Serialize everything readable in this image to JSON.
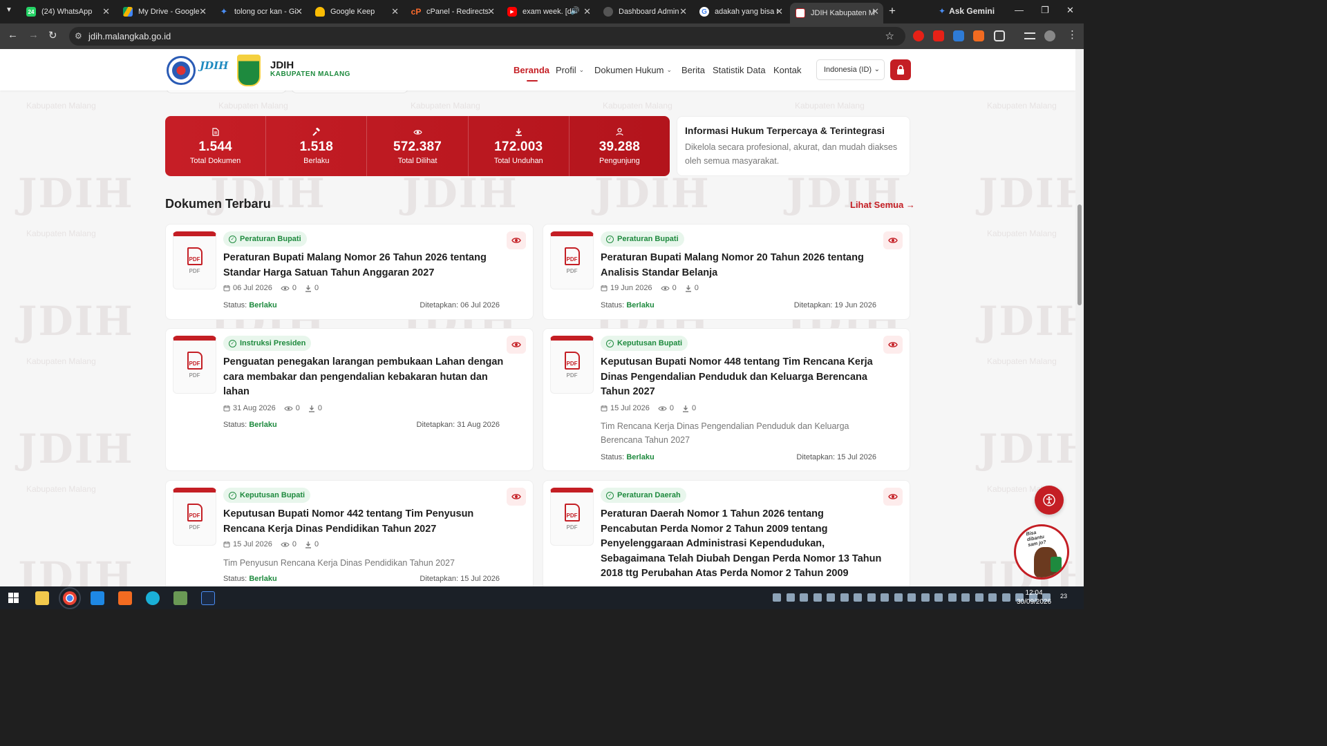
{
  "browser": {
    "tabs": [
      {
        "label": "(24) WhatsApp",
        "icon": "whatsapp-icon",
        "color": "#25d366",
        "badge": "24"
      },
      {
        "label": "My Drive - Google",
        "icon": "drive-icon",
        "color": "#f4b400"
      },
      {
        "label": "tolong ocr kan - Gi",
        "icon": "gemini-icon",
        "color": "#4b8ef5"
      },
      {
        "label": "Google Keep",
        "icon": "keep-icon",
        "color": "#fbbc04"
      },
      {
        "label": "cPanel - Redirects",
        "icon": "cpanel-icon",
        "color": "#ff6c2c"
      },
      {
        "label": "exam week. [de",
        "icon": "youtube-icon",
        "color": "#ff0000"
      },
      {
        "label": "Dashboard Admin",
        "icon": "globe-icon",
        "color": "#888888"
      },
      {
        "label": "adakah yang bisa r",
        "icon": "google-icon",
        "color": "#4285f4"
      },
      {
        "label": "JDIH Kabupaten M",
        "icon": "jdih-icon",
        "color": "#c41e24"
      }
    ],
    "ask_gemini": "Ask Gemini",
    "url": "jdih.malangkab.go.id"
  },
  "watermark": {
    "logo": "JDIH",
    "caption": "Kabupaten Malang"
  },
  "header": {
    "brand_title": "JDIH",
    "brand_sub": "KABUPATEN MALANG",
    "nav": [
      {
        "label": "Beranda",
        "active": true
      },
      {
        "label": "Profil",
        "dropdown": true
      },
      {
        "label": "Dokumen Hukum",
        "dropdown": true
      },
      {
        "label": "Berita"
      },
      {
        "label": "Statistik Data"
      },
      {
        "label": "Kontak"
      }
    ],
    "language": "Indonesia (ID)"
  },
  "stats": [
    {
      "icon": "document-icon",
      "value": "1.544",
      "label": "Total Dokumen"
    },
    {
      "icon": "gavel-icon",
      "value": "1.518",
      "label": "Berlaku"
    },
    {
      "icon": "eye-icon",
      "value": "572.387",
      "label": "Total Dilihat"
    },
    {
      "icon": "download-icon",
      "value": "172.003",
      "label": "Total Unduhan"
    },
    {
      "icon": "user-icon",
      "value": "39.288",
      "label": "Pengunjung"
    }
  ],
  "info": {
    "title": "Informasi Hukum Terpercaya & Terintegrasi",
    "text": "Dikelola secara profesional, akurat, dan mudah diakses oleh semua masyarakat."
  },
  "section": {
    "title": "Dokumen Terbaru",
    "see_all": "Lihat Semua →"
  },
  "documents": [
    {
      "category": "Peraturan Bupati",
      "title_lines": [
        "Peraturan Bupati Malang Nomor 26 Tahun 2026 tentang",
        "Standar Harga Satuan Tahun Anggaran 2027"
      ],
      "date": "06 Jul 2026",
      "views": "0",
      "downloads": "0",
      "description": "",
      "status_label": "Status:",
      "status": "Berlaku",
      "enacted": "Ditetapkan: 06 Jul 2026",
      "pdf_label": "PDF"
    },
    {
      "category": "Peraturan Bupati",
      "title_lines": [
        "Peraturan Bupati Malang Nomor 20 Tahun 2026 tentang",
        "Analisis Standar Belanja"
      ],
      "date": "19 Jun 2026",
      "views": "0",
      "downloads": "0",
      "description": "",
      "status_label": "Status:",
      "status": "Berlaku",
      "enacted": "Ditetapkan: 19 Jun 2026",
      "pdf_label": "PDF"
    },
    {
      "category": "Instruksi Presiden",
      "title_lines": [
        "Penguatan penegakan larangan pembukaan Lahan dengan",
        "cara membakar dan pengendalian kebakaran hutan dan",
        "lahan"
      ],
      "date": "31 Aug 2026",
      "views": "0",
      "downloads": "0",
      "description": "",
      "status_label": "Status:",
      "status": "Berlaku",
      "enacted": "Ditetapkan: 31 Aug 2026",
      "pdf_label": "PDF"
    },
    {
      "category": "Keputusan Bupati",
      "title_lines": [
        "Keputusan Bupati Nomor 448 tentang Tim Rencana Kerja",
        "Dinas Pengendalian Penduduk dan Keluarga Berencana",
        "Tahun 2027"
      ],
      "date": "15 Jul 2026",
      "views": "0",
      "downloads": "0",
      "description_lines": [
        "Tim Rencana Kerja Dinas Pengendalian Penduduk dan Keluarga",
        "Berencana Tahun 2027"
      ],
      "status_label": "Status:",
      "status": "Berlaku",
      "enacted": "Ditetapkan: 15 Jul 2026",
      "pdf_label": "PDF"
    },
    {
      "category": "Keputusan Bupati",
      "title_lines": [
        "Keputusan Bupati Nomor 442 tentang Tim Penyusun",
        "Rencana Kerja Dinas Pendidikan Tahun 2027"
      ],
      "date": "15 Jul 2026",
      "views": "0",
      "downloads": "0",
      "description_lines": [
        "Tim Penyusun Rencana Kerja Dinas Pendidikan Tahun 2027"
      ],
      "status_label": "Status:",
      "status": "Berlaku",
      "enacted": "Ditetapkan: 15 Jul 2026",
      "pdf_label": "PDF"
    },
    {
      "category": "Peraturan Daerah",
      "title_lines": [
        "Peraturan Daerah Nomor 1 Tahun 2026 tentang",
        "Pencabutan Perda Nomor 2 Tahun 2009 tentang",
        "Penyelenggaraan Administrasi Kependudukan,",
        "Sebagaimana Telah Diubah Dengan Perda Nomor 13 Tahun",
        "2018 ttg Perubahan Atas Perda Nomor 2 Tahun 2009"
      ],
      "pdf_label": "PDF"
    }
  ],
  "mascot_text": [
    "Bisa",
    "dibantu",
    "sam jo?"
  ],
  "taskbar": {
    "time": "12:04",
    "date": "30/09/2026",
    "notifications": "23"
  },
  "colors": {
    "primary": "#c41e24",
    "green": "#1e8a3e"
  }
}
